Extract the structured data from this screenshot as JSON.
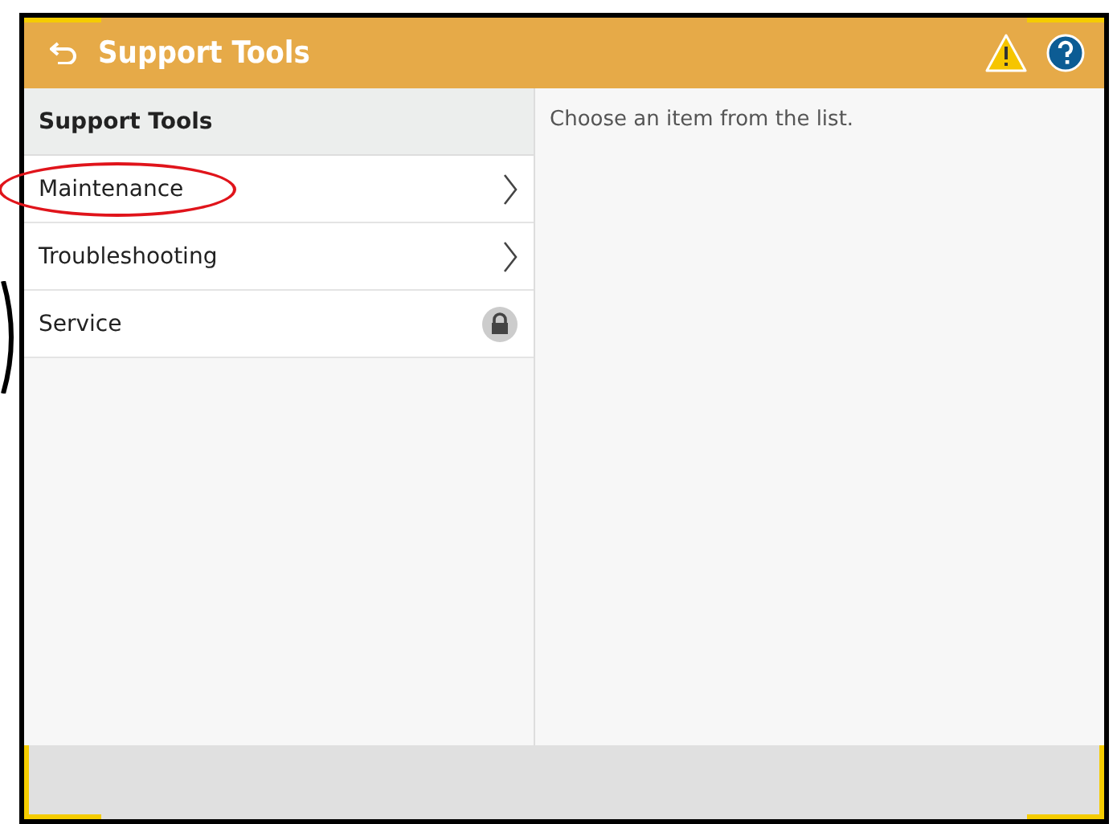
{
  "header": {
    "title": "Support Tools"
  },
  "list": {
    "title": "Support Tools",
    "items": [
      {
        "label": "Maintenance",
        "kind": "arrow",
        "circled": true
      },
      {
        "label": "Troubleshooting",
        "kind": "arrow",
        "circled": false
      },
      {
        "label": "Service",
        "kind": "locked",
        "circled": false
      }
    ]
  },
  "detail": {
    "message": "Choose an item from the list."
  }
}
